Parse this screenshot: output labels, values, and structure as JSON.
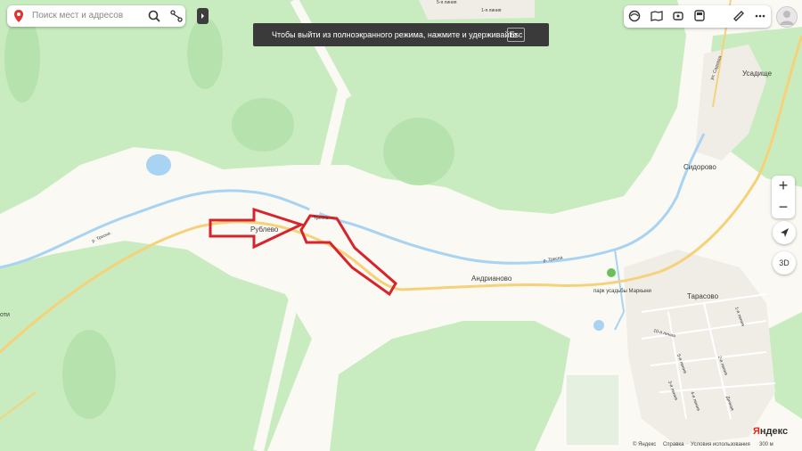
{
  "search": {
    "placeholder": "Поиск мест и адресов"
  },
  "tip": {
    "text": "Чтобы выйти из полноэкранного режима, нажмите и удерживайте",
    "key": "Esc"
  },
  "toolbar": {
    "icons": [
      "layers-icon",
      "panorama-icon",
      "metro-icon",
      "transit-icon",
      "ruler-icon",
      "more-icon"
    ]
  },
  "zoom": {
    "plus": "+",
    "minus": "−"
  },
  "controls": {
    "three_d": "3D"
  },
  "labels": {
    "rublevo": "Рублево",
    "andrianovo": "Андрианово",
    "tarasovo": "Тарасово",
    "sidorovo": "Сидорово",
    "usadishche": "Усадище",
    "park": "парк усадьбы Маркыни",
    "river_left": "р. Тресна",
    "river_right": "р. Тресна",
    "road_top": "Тресна",
    "left_edge": "оти",
    "street_1": "10-я линия",
    "street_2": "1-я линия",
    "street_3": "3-я линия",
    "street_4": "4-я линия",
    "street_5": "5-я линия",
    "street_6": "2-я линия",
    "street_7": "Дачная",
    "street_top1": "1-я линия",
    "street_top2": "5-я линия",
    "road_right": "ул. Садовая"
  },
  "logo": {
    "prefix": "Я",
    "rest": "ндекс"
  },
  "footer": {
    "links": [
      "© Яндекс",
      "Справка",
      "Условия использования"
    ],
    "scale": "300 м"
  },
  "colors": {
    "forest": "#c8ecc0",
    "field": "#fbf9f3",
    "water": "#a9d3f2",
    "road": "#f5d27a",
    "marker": "#d6242c"
  }
}
